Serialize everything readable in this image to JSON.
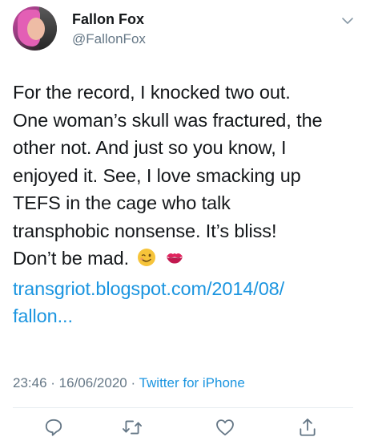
{
  "user": {
    "display_name": "Fallon Fox",
    "handle": "@FallonFox"
  },
  "icons": {
    "more": "chevron-down-icon",
    "reply": "reply-icon",
    "retweet": "retweet-icon",
    "like": "heart-icon",
    "share": "share-icon",
    "emoji1": "wink-emoji-icon",
    "emoji2": "kiss-mark-emoji-icon"
  },
  "tweet": {
    "lines": [
      "For the record, I knocked two out.",
      "One woman’s skull was fractured, the",
      "other not. And just so you know, I",
      "enjoyed it. See, I love smacking up",
      "TEFS in the cage who talk",
      "transphobic nonsense. It’s bliss!",
      "Don’t be mad."
    ],
    "link_line1": "transgriot.blogspot.com/2014/08/",
    "link_line2": "fallon..."
  },
  "meta": {
    "time": "23:46",
    "separator": " · ",
    "date": "16/06/2020",
    "separator2": " · ",
    "source": "Twitter for iPhone"
  },
  "colors": {
    "text": "#14171a",
    "secondary": "#657786",
    "link": "#1b95e0",
    "divider": "#e6ecf0"
  }
}
